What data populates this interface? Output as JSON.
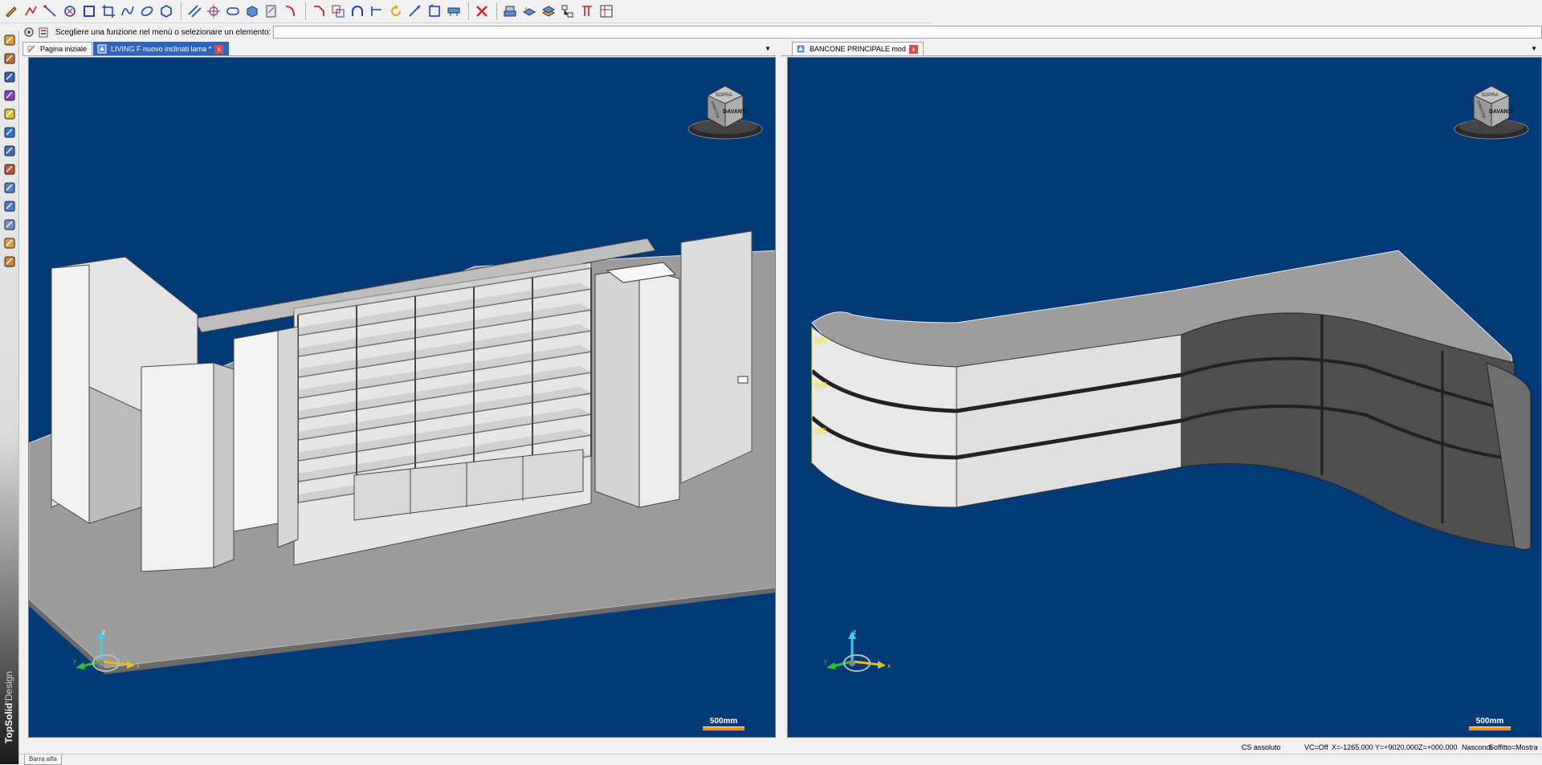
{
  "toolbar": {
    "icons": [
      "pencil-icon",
      "polyline-icon",
      "line-icon",
      "circle-x-icon",
      "rectangle-icon",
      "crop-icon",
      "spline-icon",
      "ellipse-icon",
      "hexagon-icon",
      "parallel-lines-icon",
      "point-target-icon",
      "slot-icon",
      "box-3d-icon",
      "sketch-icon",
      "fillet-icon",
      "chamfer-icon",
      "offset-icon",
      "arc-icon",
      "trim-icon",
      "rotate-icon",
      "dimension-icon",
      "transform-icon",
      "measure-icon",
      "delete-icon",
      "stack-icon",
      "layers-icon",
      "layers2-icon",
      "tree-icon",
      "hierarchy-icon",
      "table-icon"
    ]
  },
  "prompt": {
    "text": "Scegliere una funzione nel menù o selezionare un elemento:",
    "input_value": ""
  },
  "sidebar": {
    "tools": [
      "sketch-tool-icon",
      "ruler-tool-icon",
      "block-tool-icon",
      "shape-tool-icon",
      "tag-tool-icon",
      "target-tool-icon",
      "gear-tool-icon",
      "assembly-tool-icon",
      "wall-tool-icon",
      "panel-tool-icon",
      "edge-tool-icon",
      "color-tool-icon",
      "material-tool-icon"
    ],
    "brand_main": "TopSolid",
    "brand_sub": "'Design"
  },
  "left_tabs": [
    {
      "label": "Pagina iniziale",
      "active": false
    },
    {
      "label": "LIVING  F nuovo  inclinati lama *",
      "active": true,
      "close": "x"
    }
  ],
  "right_tabs": [
    {
      "label": "BANCONE PRINCIPALE mod",
      "active": false,
      "close": "x"
    }
  ],
  "dropdown_arrow": "▼",
  "viewcube": {
    "top": "SOPRA",
    "front": "DAVANTI",
    "side": "SINISTRA"
  },
  "axis": {
    "x": "x",
    "y": "y",
    "z": "z"
  },
  "left_view": {
    "scale": "500mm"
  },
  "right_view": {
    "scale": "500mm",
    "dims": [
      "385",
      "388",
      "385"
    ]
  },
  "status": {
    "cs": "CS assoluto",
    "vc": "VC=Off",
    "x": "X=-1265.000",
    "y": "Y=+9020.000",
    "z": "Z=+000.000",
    "hide": "Nascondi",
    "ceiling": "Soffitto=Mostra"
  },
  "bottom_tab": "Barra alfa",
  "colors": {
    "viewport_bg": "#023a78",
    "floor": "#9b9b9b",
    "scale_bar": "#ff9000",
    "active_tab": "#2e63b6"
  }
}
